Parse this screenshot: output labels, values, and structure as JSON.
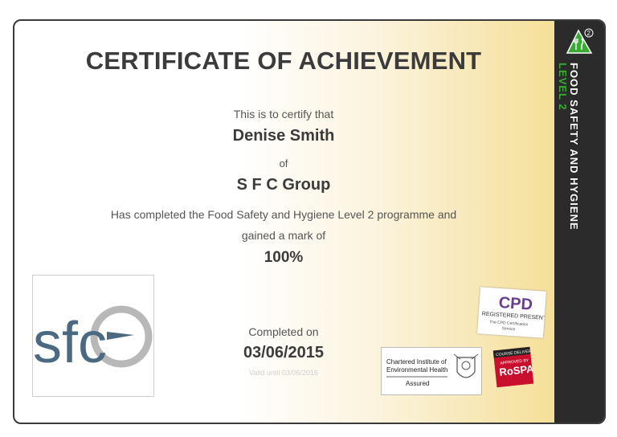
{
  "certificate": {
    "headline": "CERTIFICATE OF ACHIEVEMENT",
    "certify_text": "This is to certify that",
    "recipient": "Denise Smith",
    "of_text": "of",
    "organisation": "S F C Group",
    "description_line1": "Has completed the Food Safety and Hygiene Level 2 programme and",
    "description_line2": "gained a mark of",
    "mark": "100%",
    "completed_label": "Completed on",
    "completed_date": "03/06/2015",
    "valid_until": "Valid until 03/06/2016"
  },
  "side_panel": {
    "title": "FOOD SAFETY AND HYGIENE",
    "level": "LEVEL 2",
    "icon_number": "2",
    "icon": "fork-knife-triangle-icon"
  },
  "logo": {
    "text": "sfc",
    "icon": "sfc-logo"
  },
  "badges": {
    "cpd_title": "CPD",
    "cpd_line1": "REGISTERED PRESENTER",
    "cpd_line2": "The CPD Certification",
    "cpd_line3": "Service",
    "cieh_line1": "Chartered Institute of",
    "cieh_line2": "Environmental Health",
    "cieh_assured": "Assured",
    "rospa_top": "COURSE DELIVERY",
    "rospa_approved": "APPROVED BY",
    "rospa_name": "RoSPA"
  },
  "colors": {
    "accent_green": "#3aaa35",
    "side_dark": "#2b2b2b",
    "gradient_gold": "#f3d985",
    "logo_blue": "#4b6a82",
    "rospa_red": "#c8102e",
    "cpd_purple": "#6a3d8f"
  }
}
